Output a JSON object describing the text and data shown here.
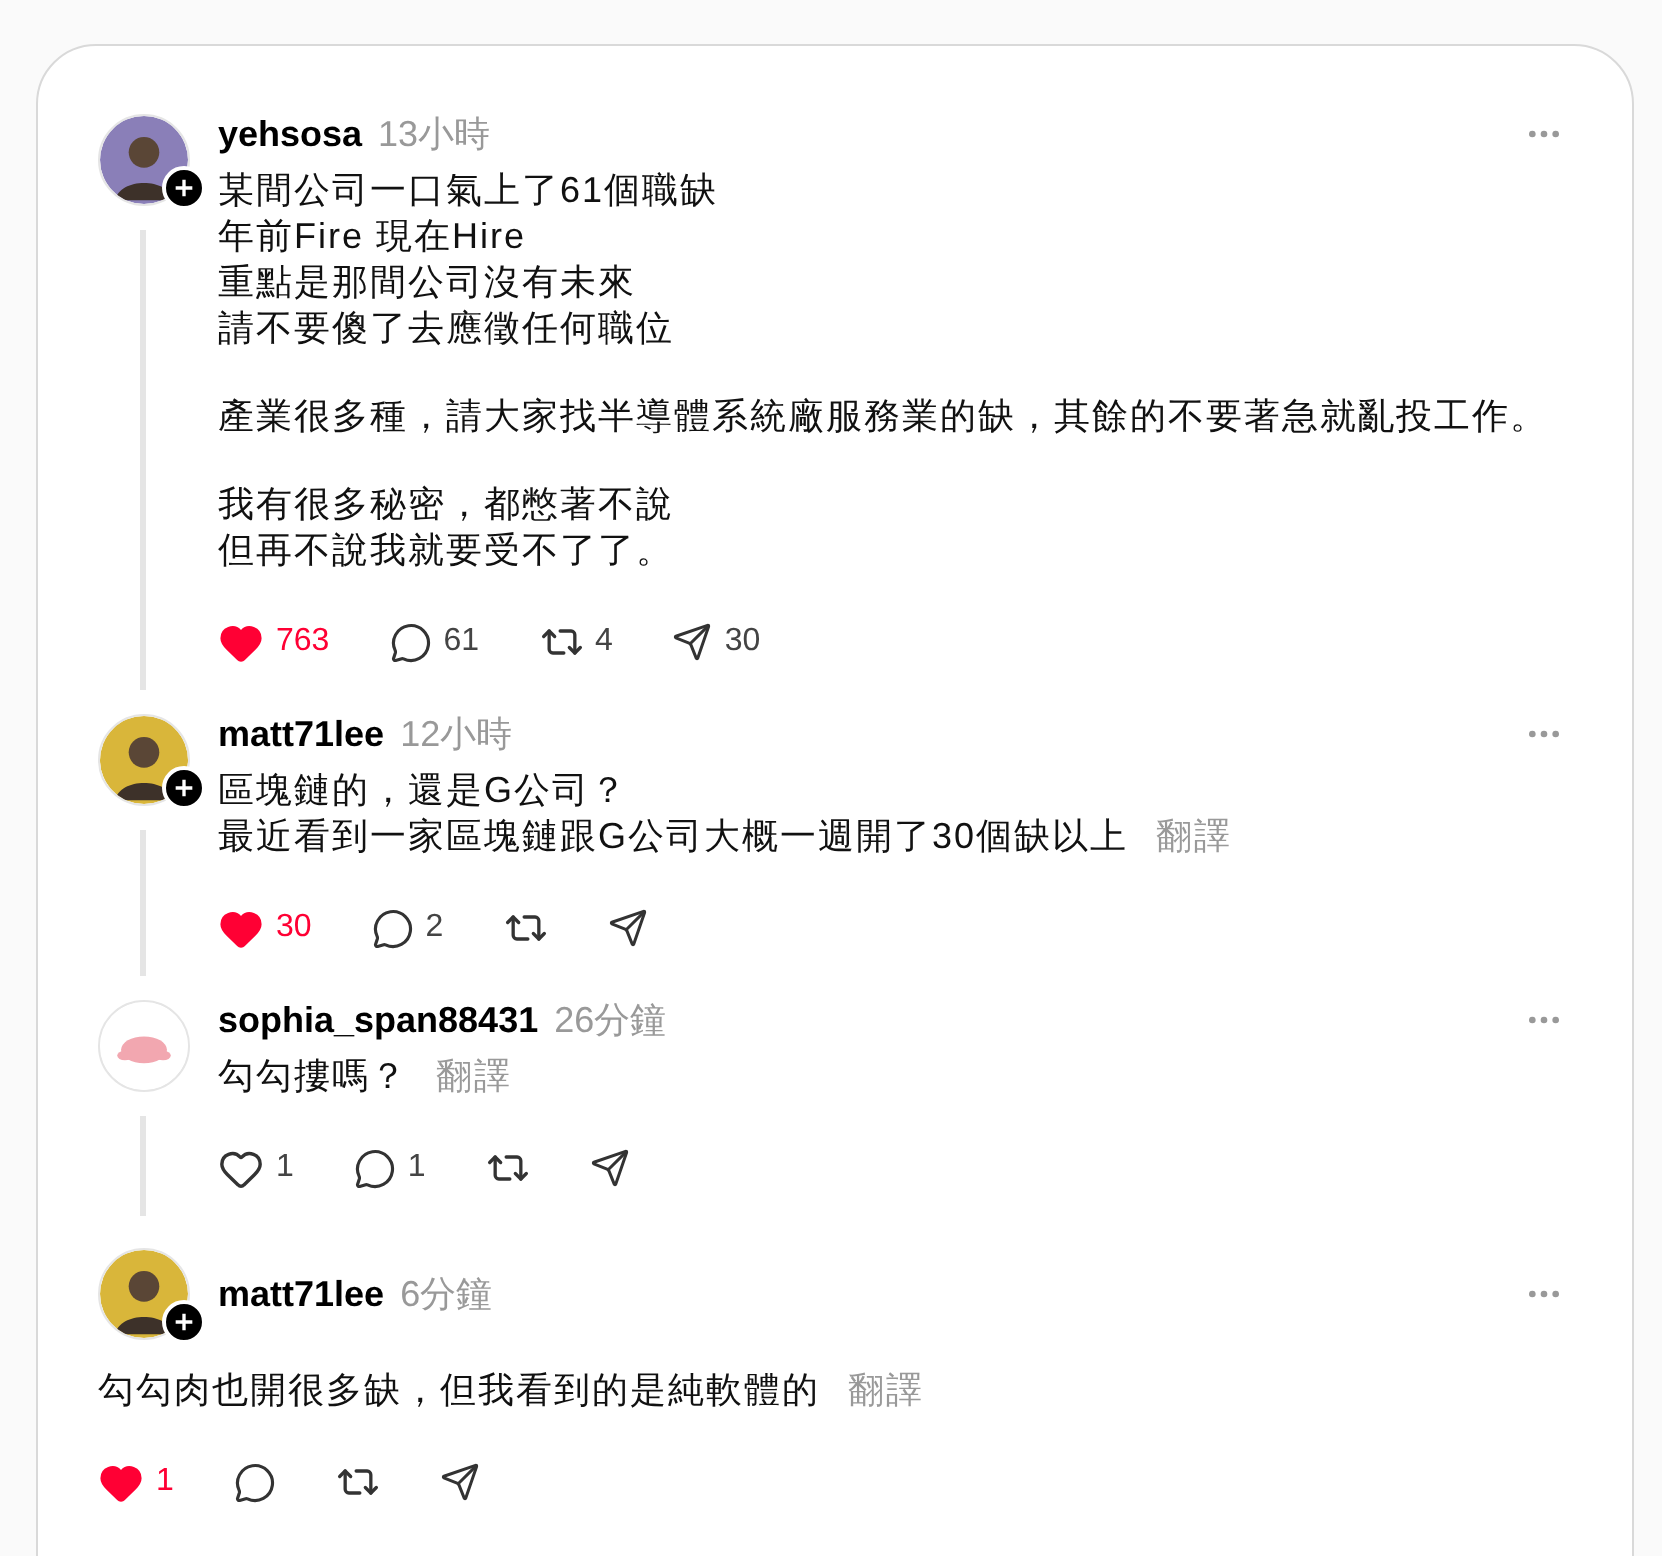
{
  "posts": [
    {
      "username": "yehsosa",
      "time": "13小時",
      "avatar": {
        "kind": "photo",
        "color": "#8a7fb8"
      },
      "follow_badge": true,
      "kind": "thread",
      "paragraphs": [
        [
          "某間公司一口氣上了61個職缺",
          "年前Fire 現在Hire",
          "重點是那間公司沒有未來",
          "請不要傻了去應徵任何職位"
        ],
        [
          "產業很多種，請大家找半導體系統廠服務業的缺，其餘的不要著急就亂投工作。"
        ],
        [
          "我有很多秘密，都憋著不說",
          "但再不說我就要受不了了。"
        ]
      ],
      "actions": {
        "liked": true,
        "likes": "763",
        "replies": "61",
        "reposts": "4",
        "shares": "30"
      }
    },
    {
      "username": "matt71lee",
      "time": "12小時",
      "avatar": {
        "kind": "photo",
        "color": "#d9b63a"
      },
      "follow_badge": true,
      "kind": "thread",
      "paragraphs": [
        [
          "區塊鏈的，還是G公司？",
          "最近看到一家區塊鏈跟G公司大概一週開了30個缺以上"
        ]
      ],
      "translate": "翻譯",
      "actions": {
        "liked": true,
        "likes": "30",
        "replies": "2"
      }
    },
    {
      "username": "sophia_span88431",
      "time": "26分鐘",
      "avatar": {
        "kind": "cartoon",
        "color": "#f2a7b0"
      },
      "follow_badge": false,
      "kind": "thread",
      "paragraphs": [
        [
          "勾勾摟嗎？"
        ]
      ],
      "translate": "翻譯",
      "actions": {
        "liked": false,
        "likes": "1",
        "replies": "1"
      }
    },
    {
      "username": "matt71lee",
      "time": "6分鐘",
      "avatar": {
        "kind": "photo",
        "color": "#d9b63a"
      },
      "follow_badge": true,
      "kind": "reply",
      "paragraphs": [
        [
          "勾勾肉也開很多缺，但我看到的是純軟體的"
        ]
      ],
      "translate": "翻譯",
      "actions": {
        "liked": true,
        "likes": "1"
      }
    }
  ]
}
